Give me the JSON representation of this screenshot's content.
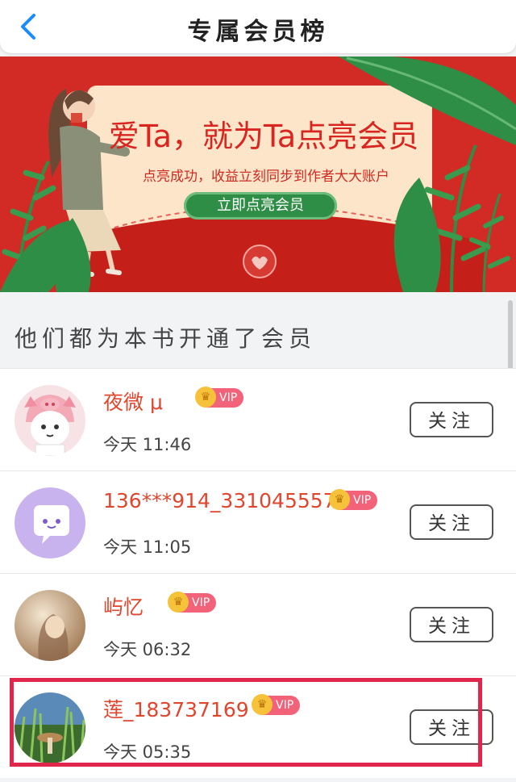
{
  "header": {
    "title": "专属会员榜",
    "back_icon": "chevron-left-icon"
  },
  "banner": {
    "headline": "爱Ta，就为Ta点亮会员",
    "subtext": "点亮成功，收益立刻同步到作者大大账户",
    "cta_label": "立即点亮会员",
    "bg_color": "#d22a25",
    "card_color": "#fde5c9"
  },
  "section": {
    "label": "他们都为本书开通了会员"
  },
  "members": [
    {
      "name": "夜微 μ",
      "badge": "VIP",
      "time": "今天 11:46",
      "follow_label": "关注"
    },
    {
      "name": "136***914_3310455574",
      "badge": "VIP",
      "time": "今天 11:05",
      "follow_label": "关注"
    },
    {
      "name": "屿忆",
      "badge": "VIP",
      "time": "今天 06:32",
      "follow_label": "关注"
    },
    {
      "name": "莲_183737169",
      "badge": "VIP",
      "time": "今天 05:35",
      "follow_label": "关注",
      "highlighted": true
    }
  ],
  "colors": {
    "accent_name": "#e0452e",
    "vip_badge": "#f2637a",
    "highlight": "#e0264a"
  }
}
